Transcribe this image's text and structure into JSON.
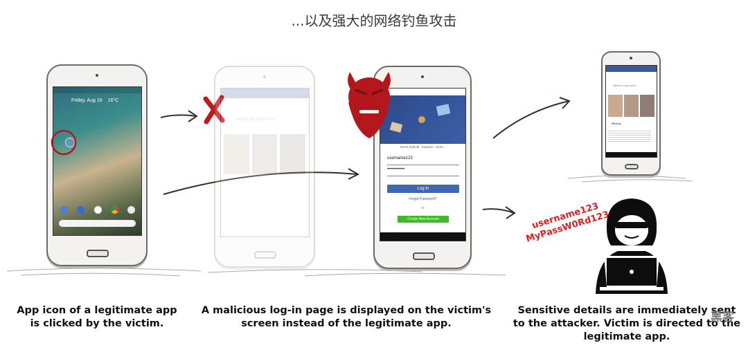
{
  "title": "...以及强大的网络钓鱼攻击",
  "captions": {
    "step1": "App icon of a legitimate app is clicked by the victim.",
    "step2": "A malicious log-in page is displayed on the victim's screen instead of the legitimate app.",
    "step3": "Sensitive details are immediately sent to the attacker. Victim is directed to the legitimate app."
  },
  "home_screen": {
    "date": "Friday, Aug 16",
    "weather": "16°C"
  },
  "fake_login": {
    "languages": "Norsk bokmål · Español · More...",
    "username": "username123",
    "password": "••••••••••••",
    "login_button": "Log In",
    "forgot_password": "Forgot Password?",
    "divider": "or",
    "create_button": "Create New Account"
  },
  "stolen_credentials": {
    "username": "username123",
    "password": "MyPassW0Rd123"
  },
  "feed": {
    "whats_on_your_mind": "What's on your mind?",
    "poster": "Whitney"
  },
  "watermark": "黑客",
  "colors": {
    "accent_red": "#e01d1d",
    "fb_blue": "#3b5998",
    "fb_green": "#42b72a"
  },
  "icons": [
    "x-mark",
    "devil-icon",
    "hacker-icon",
    "laptop-icon",
    "arrow"
  ]
}
